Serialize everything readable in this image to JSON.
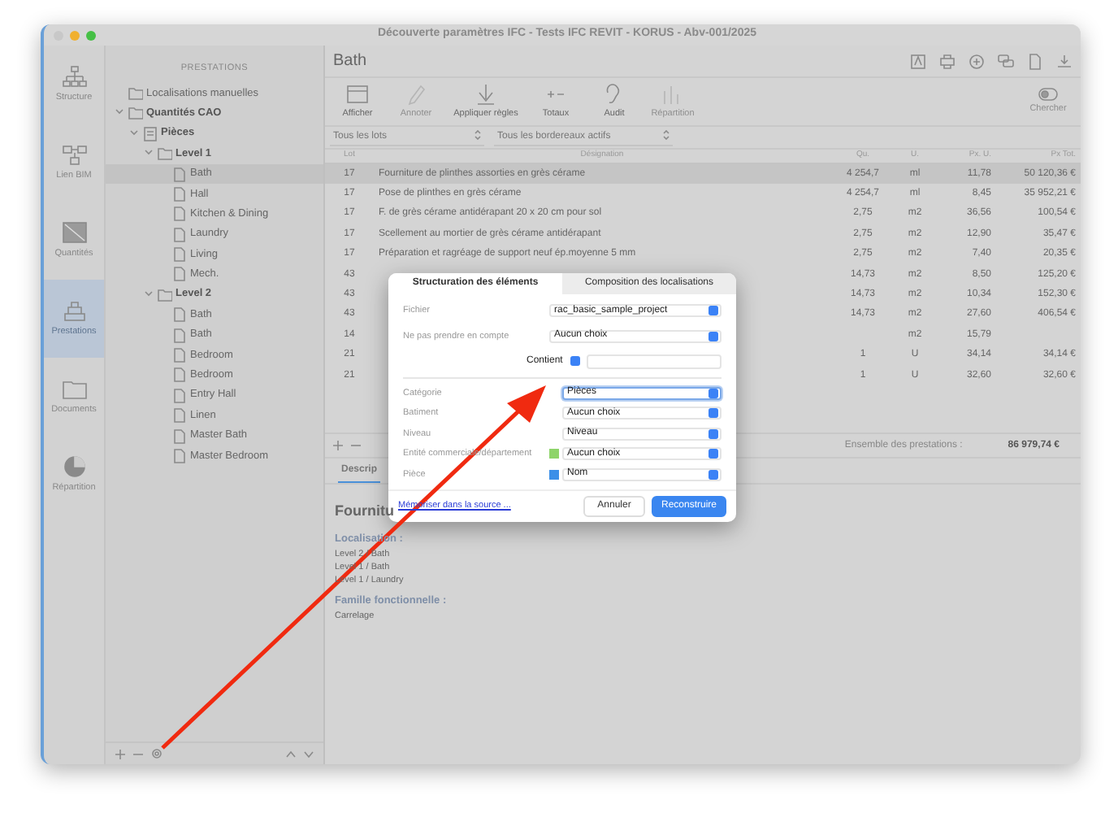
{
  "window": {
    "title": "Découverte paramètres IFC - Tests IFC REVIT - KORUS - Abv-001/2025"
  },
  "nav_rail": [
    {
      "label": "Structure",
      "kind": "structure",
      "selected": false
    },
    {
      "label": "Lien BIM",
      "kind": "link",
      "selected": false
    },
    {
      "label": "Quantités",
      "kind": "quantities",
      "selected": false
    },
    {
      "label": "Prestations",
      "kind": "services",
      "selected": true
    },
    {
      "label": "Documents",
      "kind": "documents",
      "selected": false
    },
    {
      "label": "Répartition",
      "kind": "distribution",
      "selected": false
    }
  ],
  "sidebar": {
    "title": "PRESTATIONS",
    "tree": [
      {
        "label": "Localisations manuelles",
        "kind": "folder",
        "selected": false
      },
      {
        "label": "Quantités CAO",
        "kind": "group",
        "selected": false,
        "expanded": true,
        "children": [
          {
            "label": "Pièces",
            "kind": "category",
            "selected": false,
            "expanded": true,
            "children": [
              {
                "label": "Level 1",
                "kind": "group",
                "selected": false,
                "expanded": true,
                "children": [
                  {
                    "label": "Bath",
                    "kind": "room",
                    "selected": true
                  },
                  {
                    "label": "Hall",
                    "kind": "room",
                    "selected": false
                  },
                  {
                    "label": "Kitchen & Dining",
                    "kind": "room",
                    "selected": false
                  },
                  {
                    "label": "Laundry",
                    "kind": "room",
                    "selected": false
                  },
                  {
                    "label": "Living",
                    "kind": "room",
                    "selected": false
                  },
                  {
                    "label": "Mech.",
                    "kind": "room",
                    "selected": false
                  }
                ]
              },
              {
                "label": "Level 2",
                "kind": "group",
                "selected": false,
                "expanded": true,
                "children": [
                  {
                    "label": "Bath",
                    "kind": "room",
                    "selected": false
                  },
                  {
                    "label": "Bath",
                    "kind": "room",
                    "selected": false
                  },
                  {
                    "label": "Bedroom",
                    "kind": "room",
                    "selected": false
                  },
                  {
                    "label": "Bedroom",
                    "kind": "room",
                    "selected": false
                  },
                  {
                    "label": "Entry Hall",
                    "kind": "room",
                    "selected": false
                  },
                  {
                    "label": "Linen",
                    "kind": "room",
                    "selected": false
                  },
                  {
                    "label": "Master Bath",
                    "kind": "room",
                    "selected": false
                  },
                  {
                    "label": "Master Bedroom",
                    "kind": "room",
                    "selected": false
                  }
                ]
              }
            ]
          }
        ]
      }
    ]
  },
  "main": {
    "title": "Bath",
    "toolbar": [
      {
        "label": "Afficher",
        "kind": "display",
        "disabled": false
      },
      {
        "label": "Annoter",
        "kind": "annotate",
        "disabled": true
      },
      {
        "label": "Appliquer règles",
        "kind": "apply",
        "disabled": false
      },
      {
        "label": "Totaux",
        "kind": "totals",
        "disabled": false
      },
      {
        "label": "Audit",
        "kind": "audit",
        "disabled": false
      },
      {
        "label": "Répartition",
        "kind": "distribution",
        "disabled": true
      }
    ],
    "search_toggle": {
      "label": "Chercher",
      "disabled": true
    },
    "filters": [
      {
        "value": "Tous les lots"
      },
      {
        "value": "Tous les bordereaux actifs"
      }
    ],
    "table": {
      "columns": [
        "Lot",
        "Désignation",
        "Qu.",
        "U.",
        "Px. U.",
        "Px Tot."
      ],
      "rows": [
        {
          "lot": "17",
          "designation": "Fourniture de plinthes assorties en grès cérame",
          "qty": "4 254,7",
          "unit": "ml",
          "unit_price": "11,78",
          "total": "50 120,36 €",
          "selected": true
        },
        {
          "lot": "17",
          "designation": "Pose de plinthes en grès cérame",
          "qty": "4 254,7",
          "unit": "ml",
          "unit_price": "8,45",
          "total": "35 952,21 €",
          "selected": false
        },
        {
          "lot": "17",
          "designation": "F. de grès cérame antidérapant 20 x 20 cm pour sol",
          "qty": "2,75",
          "unit": "m2",
          "unit_price": "36,56",
          "total": "100,54 €",
          "selected": false
        },
        {
          "lot": "17",
          "designation": "Scellement au mortier de grès cérame antidérapant",
          "qty": "2,75",
          "unit": "m2",
          "unit_price": "12,90",
          "total": "35,47 €",
          "selected": false
        },
        {
          "lot": "17",
          "designation": "Préparation et ragréage de support neuf ép.moyenne 5 mm",
          "qty": "2,75",
          "unit": "m2",
          "unit_price": "7,40",
          "total": "20,35 €",
          "selected": false
        },
        {
          "lot": "43",
          "qty": "14,73",
          "unit": "m2",
          "unit_price": "8,50",
          "total": "125,20 €",
          "selected": false
        },
        {
          "lot": "43",
          "qty": "14,73",
          "unit": "m2",
          "unit_price": "10,34",
          "total": "152,30 €",
          "selected": false
        },
        {
          "lot": "43",
          "qty": "14,73",
          "unit": "m2",
          "unit_price": "27,60",
          "total": "406,54 €",
          "selected": false
        },
        {
          "lot": "14",
          "unit": "m2",
          "unit_price": "15,79",
          "selected": false
        },
        {
          "lot": "21",
          "qty": "1",
          "unit": "U",
          "unit_price": "34,14",
          "total": "34,14 €",
          "selected": false
        },
        {
          "lot": "21",
          "qty": "1",
          "unit": "U",
          "unit_price": "32,60",
          "total": "32,60 €",
          "selected": false
        }
      ]
    },
    "total_label": "Ensemble des prestations :",
    "total_value": "86 979,74 €",
    "detail_tabs": [
      {
        "label": "Descrip",
        "selected": true
      }
    ],
    "detail": {
      "title": "Fournitu",
      "sections": [
        {
          "heading": "Localisation :",
          "lines": [
            "Level 2 / Bath",
            "Level 1 / Bath",
            "Level 1 / Laundry"
          ]
        },
        {
          "heading": "Famille fonctionnelle :",
          "lines": [
            "Carrelage"
          ]
        }
      ]
    }
  },
  "dialog": {
    "tabs": [
      {
        "label": "Structuration des éléments",
        "selected": true
      },
      {
        "label": "Composition des localisations",
        "selected": false
      }
    ],
    "source_fields": [
      {
        "label": "Fichier",
        "kind": "select",
        "value": "rac_basic_sample_project"
      },
      {
        "label": "Ne pas prendre en compte",
        "kind": "select",
        "value": "Aucun choix"
      },
      {
        "kind": "condition",
        "value": "Contient"
      }
    ],
    "mapping_fields": [
      {
        "label": "Catégorie",
        "value": "Pièces",
        "focused": true
      },
      {
        "label": "Batiment",
        "value": "Aucun choix",
        "focused": false
      },
      {
        "label": "Niveau",
        "value": "Niveau",
        "focused": false
      },
      {
        "label": "Entité commerciale/département",
        "value": "Aucun choix",
        "focused": false,
        "color": "#8ed46a"
      },
      {
        "label": "Pièce",
        "value": "Nom",
        "focused": false,
        "color": "#3b8fe8"
      }
    ],
    "link": "Mémoriser dans la source ...",
    "buttons": [
      {
        "label": "Annuler",
        "kind": "cancel"
      },
      {
        "label": "Reconstruire",
        "kind": "default"
      }
    ]
  }
}
